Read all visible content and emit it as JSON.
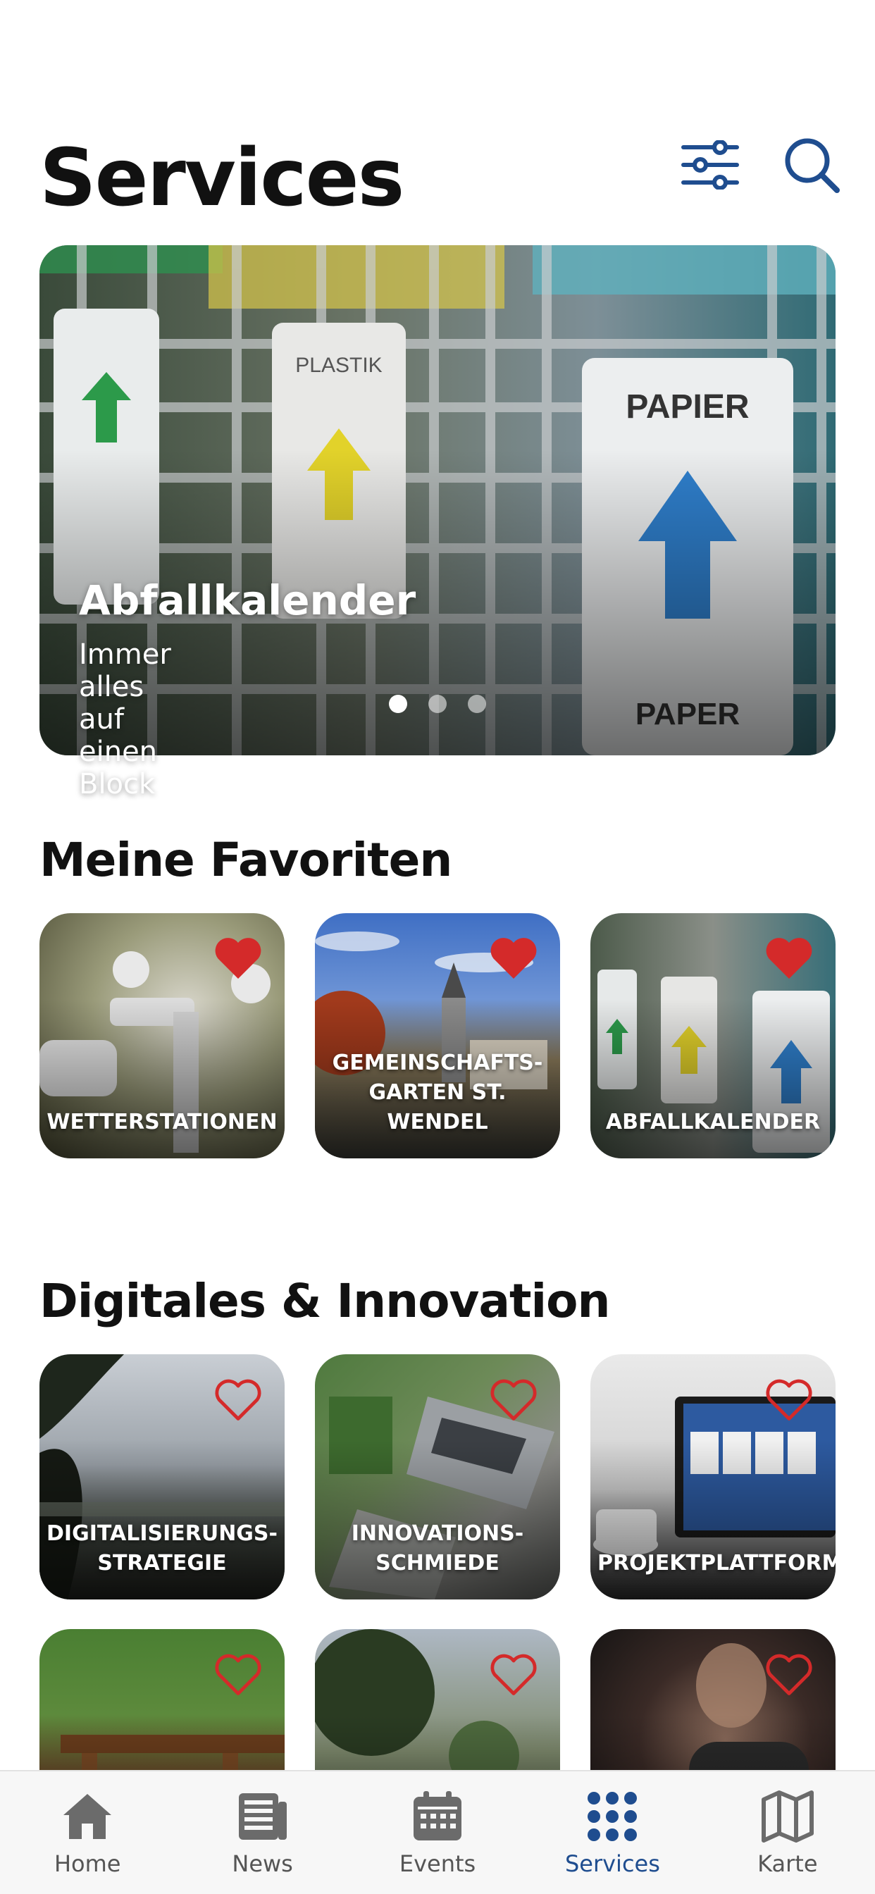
{
  "status": {
    "time": ""
  },
  "header": {
    "title": "Services",
    "filter_icon": "sliders-icon",
    "search_icon": "search-icon",
    "accent_color": "#1f4d8f"
  },
  "hero": {
    "title": "Abfallkalender",
    "subtitle": "Immer alles auf einen Block",
    "slides": 3,
    "active_slide": 1
  },
  "favorites": {
    "title": "Meine Favoriten",
    "items": [
      {
        "label": "WETTERSTATIONEN",
        "favorite": true
      },
      {
        "label": "GEMEINSCHAFTS-GARTEN ST. WENDEL",
        "favorite": true
      },
      {
        "label": "ABFALLKALENDER",
        "favorite": true
      }
    ]
  },
  "digital": {
    "title": "Digitales & Innovation",
    "items": [
      {
        "label": "DIGITALISIERUNGS-STRATEGIE",
        "favorite": false
      },
      {
        "label": "INNOVATIONS-SCHMIEDE",
        "favorite": false
      },
      {
        "label": "PROJEKTPLATTFORM",
        "favorite": false
      },
      {
        "label": "",
        "favorite": false
      },
      {
        "label": "",
        "favorite": false
      },
      {
        "label": "",
        "favorite": false
      }
    ]
  },
  "tabbar": {
    "items": [
      {
        "label": "Home",
        "icon": "home-icon"
      },
      {
        "label": "News",
        "icon": "newspaper-icon"
      },
      {
        "label": "Events",
        "icon": "calendar-icon"
      },
      {
        "label": "Services",
        "icon": "grid-dots-icon",
        "active": true
      },
      {
        "label": "Karte",
        "icon": "map-icon"
      }
    ]
  },
  "colors": {
    "heart_red": "#d42a2a",
    "tab_active": "#1f4d8f",
    "tab_inactive": "#6b6b6b"
  }
}
